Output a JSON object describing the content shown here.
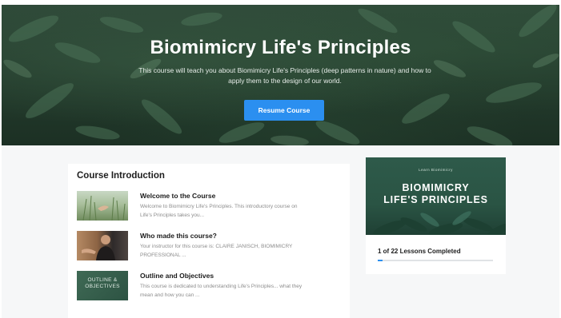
{
  "hero": {
    "title": "Biomimicry Life's Principles",
    "description": "This course will teach you about Biomimicry Life's Principles (deep patterns in nature) and how to apply them to the design of our world.",
    "resume_label": "Resume Course"
  },
  "intro": {
    "heading": "Course Introduction",
    "lessons": [
      {
        "title": "Welcome to the Course",
        "description": "Welcome to Biomimicry Life's Principles. This introductory course on Life's Principles takes you...",
        "thumb_text": ""
      },
      {
        "title": "Who made this course?",
        "description": "Your instructor for this course is: CLAIRE JANISCH, BIOMIMICRY PROFESSIONAL ...",
        "thumb_text": ""
      },
      {
        "title": "Outline and Objectives",
        "description": "This course is dedicated to understanding Life's Principles... what they mean and how you can ...",
        "thumb_text": "OUTLINE & OBJECTIVES"
      }
    ]
  },
  "side": {
    "cover_kicker": "Learn Biomimicry",
    "cover_title_line1": "BIOMIMICRY",
    "cover_title_line2": "LIFE'S PRINCIPLES",
    "progress_text": "1 of 22 Lessons Completed",
    "progress_fraction": 0.045
  },
  "colors": {
    "accent": "#2b8ff0",
    "hero_dark_green": "#233b2c",
    "cover_green": "#2e5a4a"
  }
}
